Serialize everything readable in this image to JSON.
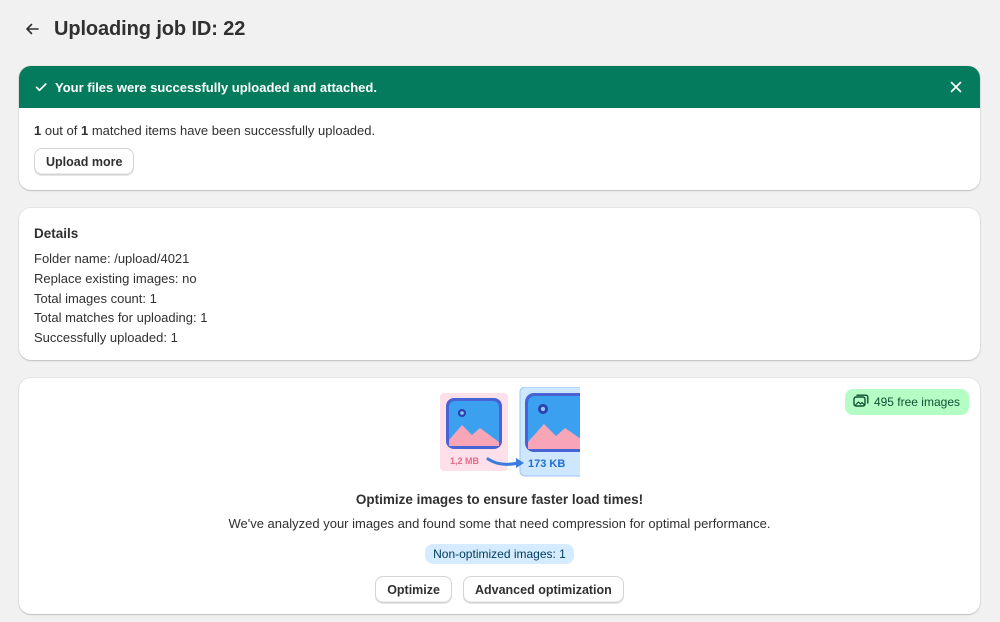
{
  "header": {
    "title": "Uploading job ID: 22"
  },
  "success": {
    "banner_text": "Your files were successfully uploaded and attached.",
    "summary": {
      "uploaded_count": "1",
      "text_out_of": " out of ",
      "matched_count": "1",
      "text_suffix": " matched items have been successfully uploaded."
    },
    "upload_more_label": "Upload more"
  },
  "details": {
    "title": "Details",
    "lines": [
      "Folder name: /upload/4021",
      "Replace existing images: no",
      "Total images count: 1",
      "Total matches for uploading: 1",
      "Successfully uploaded: 1"
    ]
  },
  "optimize": {
    "free_images_badge": "495 free images",
    "before_size": "1,2 MB",
    "after_size": "173 KB",
    "title": "Optimize images to ensure faster load times!",
    "description": "We've analyzed your images and found some that need compression for optimal performance.",
    "non_optimized_pill": "Non-optimized images: 1",
    "optimize_label": "Optimize",
    "advanced_label": "Advanced optimization"
  },
  "colors": {
    "banner_bg": "#047b5d",
    "badge_bg": "#b4fec5",
    "pill_bg": "#d5ebff",
    "page_bg": "#f1f1f1"
  }
}
